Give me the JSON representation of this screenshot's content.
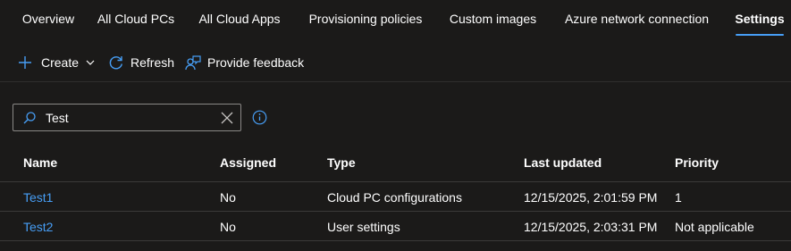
{
  "tabs": [
    {
      "label": "Overview",
      "active": false
    },
    {
      "label": "All Cloud PCs",
      "active": false
    },
    {
      "label": "All Cloud Apps",
      "active": false
    },
    {
      "label": "Provisioning policies",
      "active": false
    },
    {
      "label": "Custom images",
      "active": false
    },
    {
      "label": "Azure network connection",
      "active": false
    },
    {
      "label": "Settings",
      "active": true
    }
  ],
  "toolbar": {
    "create_label": "Create",
    "refresh_label": "Refresh",
    "feedback_label": "Provide feedback",
    "icons": [
      "plus-icon",
      "chevron-down-icon",
      "refresh-icon",
      "feedback-icon"
    ]
  },
  "search": {
    "value": "Test",
    "icons": [
      "search-icon",
      "clear-icon",
      "info-icon"
    ]
  },
  "table": {
    "columns": [
      "Name",
      "Assigned",
      "Type",
      "Last updated",
      "Priority"
    ],
    "rows": [
      {
        "name": "Test1",
        "assigned": "No",
        "type": "Cloud PC configurations",
        "last_updated": "12/15/2025, 2:01:59 PM",
        "priority": "1"
      },
      {
        "name": "Test2",
        "assigned": "No",
        "type": "User settings",
        "last_updated": "12/15/2025, 2:03:31 PM",
        "priority": "Not applicable"
      }
    ]
  },
  "colors": {
    "background": "#1b1a19",
    "accent": "#479ef5",
    "text": "#ffffff",
    "border": "#8a8886"
  }
}
